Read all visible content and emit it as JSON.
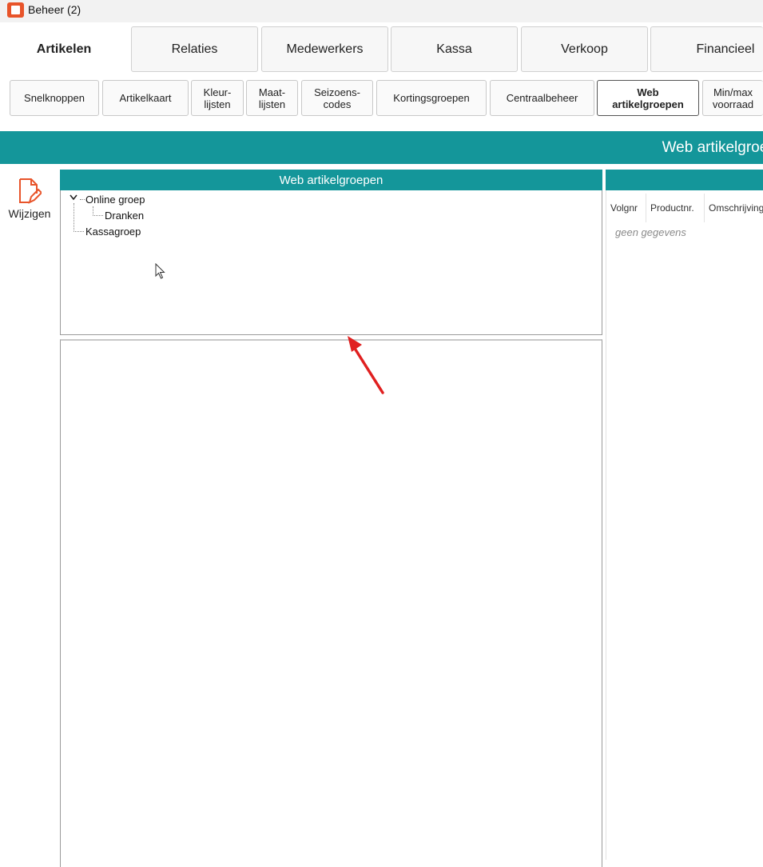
{
  "window": {
    "title": "Beheer (2)"
  },
  "main_tabs": [
    {
      "label": "Artikelen",
      "active": true
    },
    {
      "label": "Relaties",
      "active": false
    },
    {
      "label": "Medewerkers",
      "active": false
    },
    {
      "label": "Kassa",
      "active": false
    },
    {
      "label": "Verkoop",
      "active": false
    },
    {
      "label": "Financieel",
      "active": false
    }
  ],
  "sub_tabs": [
    {
      "label": "Snelknoppen",
      "active": false
    },
    {
      "label": "Artikelkaart",
      "active": false
    },
    {
      "label": "Kleur-\nlijsten",
      "active": false
    },
    {
      "label": "Maat-\nlijsten",
      "active": false
    },
    {
      "label": "Seizoens-\ncodes",
      "active": false
    },
    {
      "label": "Kortingsgroepen",
      "active": false
    },
    {
      "label": "Centraalbeheer",
      "active": false
    },
    {
      "label": "Web\nartikelgroepen",
      "active": true
    },
    {
      "label": "Min/max\nvoorraad",
      "active": false
    }
  ],
  "section": {
    "title": "Web artikelgroepen"
  },
  "actions": {
    "edit_label": "Wijzigen"
  },
  "tree_panel": {
    "title": "Web artikelgroepen",
    "nodes": [
      {
        "label": "Online groep",
        "expanded": true
      },
      {
        "label": "Dranken"
      },
      {
        "label": "Kassagroep"
      }
    ]
  },
  "grid": {
    "columns": [
      "Volgnr",
      "Productnr.",
      "Omschrijving"
    ],
    "empty_text": "geen gegevens"
  },
  "colors": {
    "accent": "#14969a",
    "brand": "#e8542a",
    "annotation_arrow": "#e02020"
  }
}
